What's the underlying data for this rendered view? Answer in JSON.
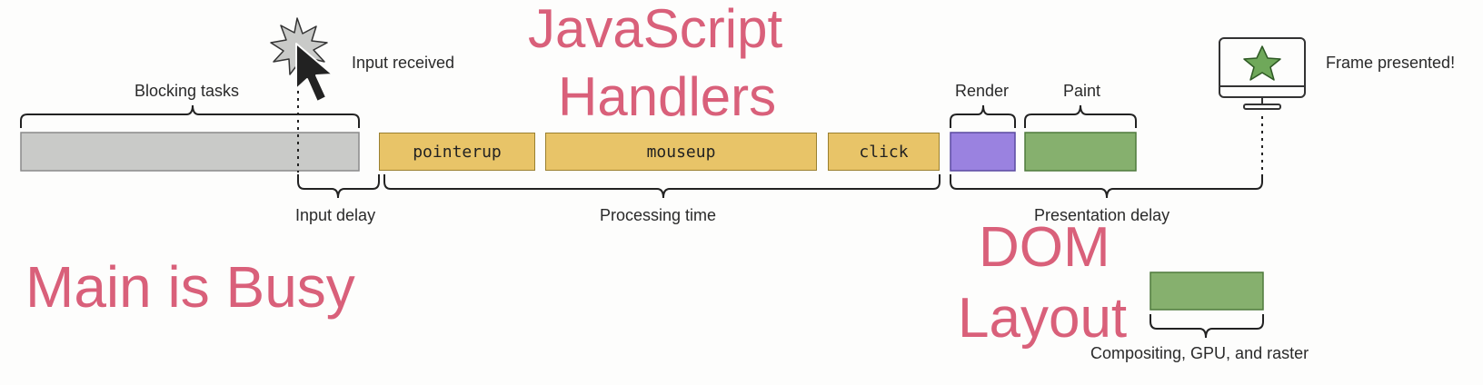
{
  "labels": {
    "blocking_tasks": "Blocking tasks",
    "input_received": "Input received",
    "input_delay": "Input delay",
    "processing_time": "Processing time",
    "render": "Render",
    "paint": "Paint",
    "presentation_delay": "Presentation delay",
    "frame_presented": "Frame presented!",
    "compositing": "Compositing, GPU, and raster"
  },
  "tasks": {
    "pointerup": "pointerup",
    "mouseup": "mouseup",
    "click": "click"
  },
  "annotations": {
    "js_line1": "JavaScript",
    "js_line2": "Handlers",
    "main_busy": "Main is Busy",
    "dom": "DOM",
    "layout": "Layout"
  },
  "colors": {
    "blocking": "#c9cac8",
    "handler": "#e8c468",
    "render": "#9a82e0",
    "paint": "#86b06e",
    "annotation": "#d9607a"
  }
}
